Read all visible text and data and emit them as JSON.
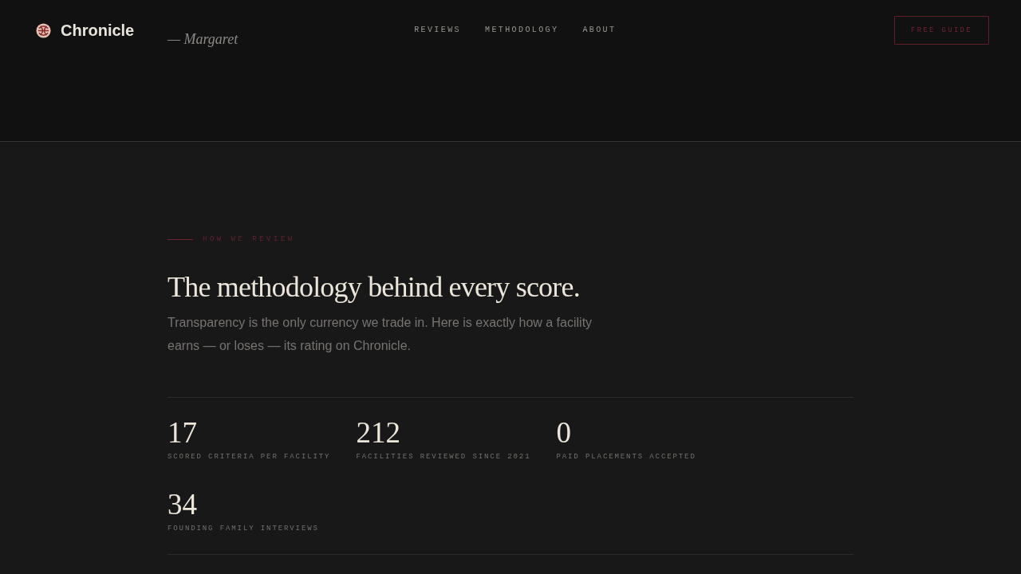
{
  "header": {
    "brand": "Chronicle",
    "byline": "— Margaret",
    "nav": [
      {
        "label": "REVIEWS"
      },
      {
        "label": "METHODOLOGY"
      },
      {
        "label": "ABOUT"
      }
    ],
    "cta": "FREE GUIDE"
  },
  "section": {
    "eyebrow": "HOW WE REVIEW",
    "heading": "The methodology behind every score.",
    "intro": "Transparency is the only currency we trade in. Here is exactly how a facility earns — or loses — its rating on Chronicle.",
    "stats": [
      {
        "value": "17",
        "label": "SCORED CRITERIA PER FACILITY"
      },
      {
        "value": "212",
        "label": "FACILITIES REVIEWED SINCE 2021"
      },
      {
        "value": "0",
        "label": "PAID PLACEMENTS ACCEPTED"
      },
      {
        "value": "34",
        "label": "FOUNDING FAMILY INTERVIEWS"
      }
    ]
  }
}
